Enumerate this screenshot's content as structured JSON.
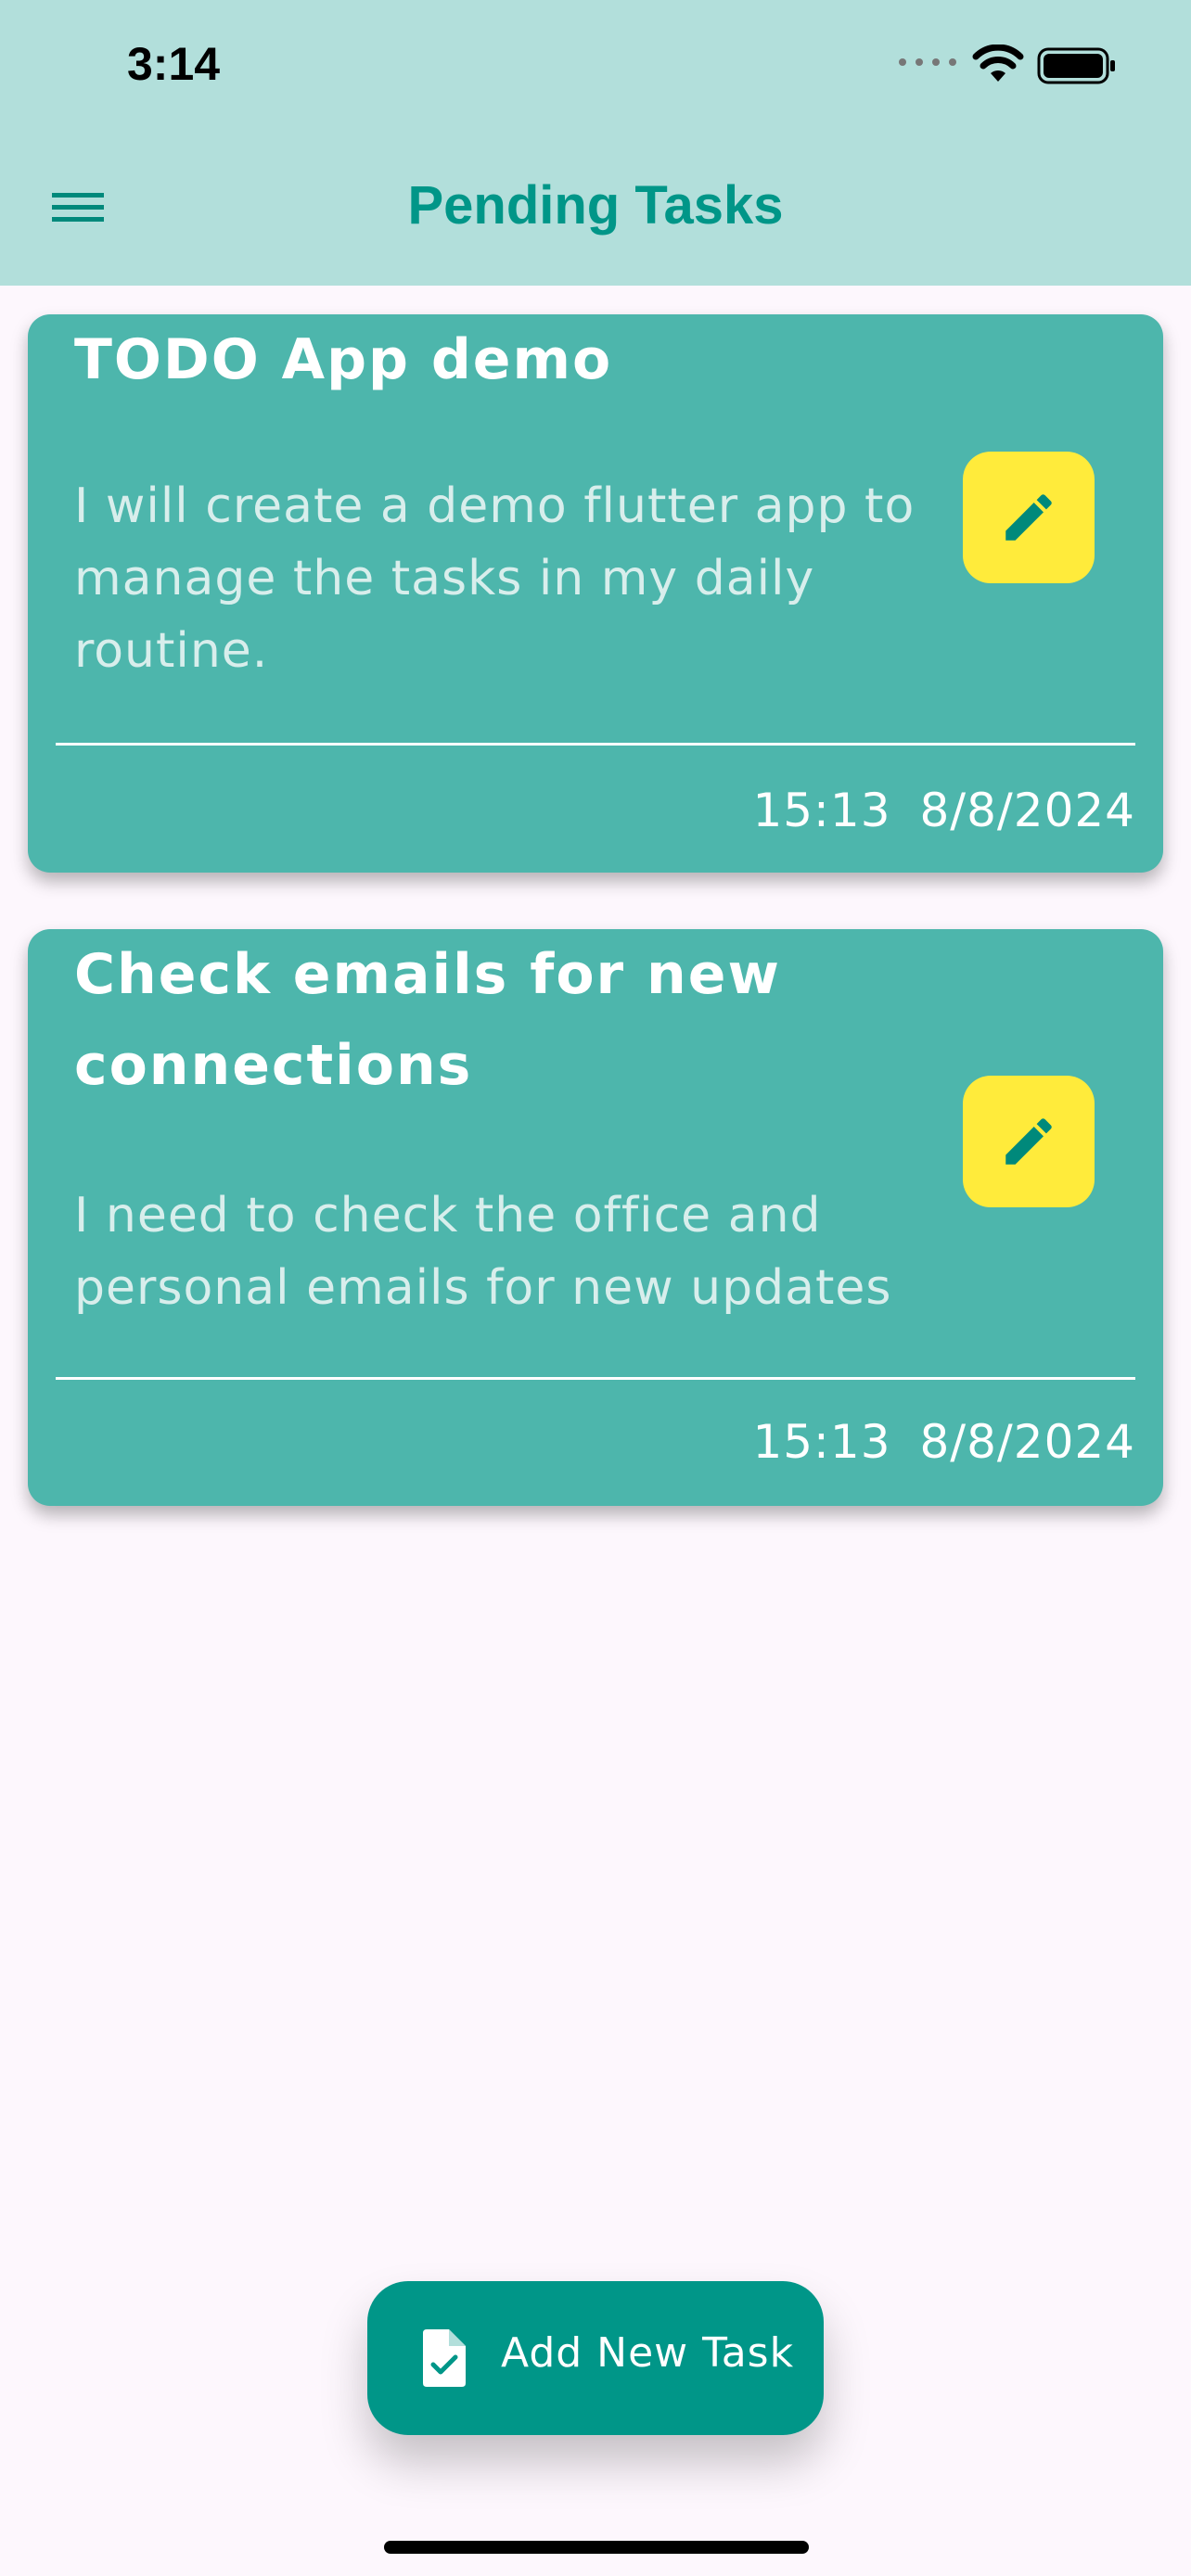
{
  "status_bar": {
    "time": "3:14"
  },
  "app_bar": {
    "title": "Pending Tasks",
    "menu_icon": "menu-icon"
  },
  "tasks": [
    {
      "title": "TODO App demo",
      "description": "I will create a demo flutter app to manage the tasks in my daily routine.",
      "time": "15:13",
      "date": "8/8/2024",
      "edit_icon": "pencil-icon"
    },
    {
      "title": "Check emails for new connections",
      "description": "I need to check the office and personal emails for new updates",
      "time": "15:13",
      "date": "8/8/2024",
      "edit_icon": "pencil-icon"
    }
  ],
  "fab": {
    "label": "Add New Task",
    "icon": "file-check-icon"
  },
  "colors": {
    "header": "#b2dfdb",
    "accent": "#009688",
    "card": "#4db6ac",
    "edit_button": "#ffeb3b",
    "background": "#fdf7fd"
  }
}
